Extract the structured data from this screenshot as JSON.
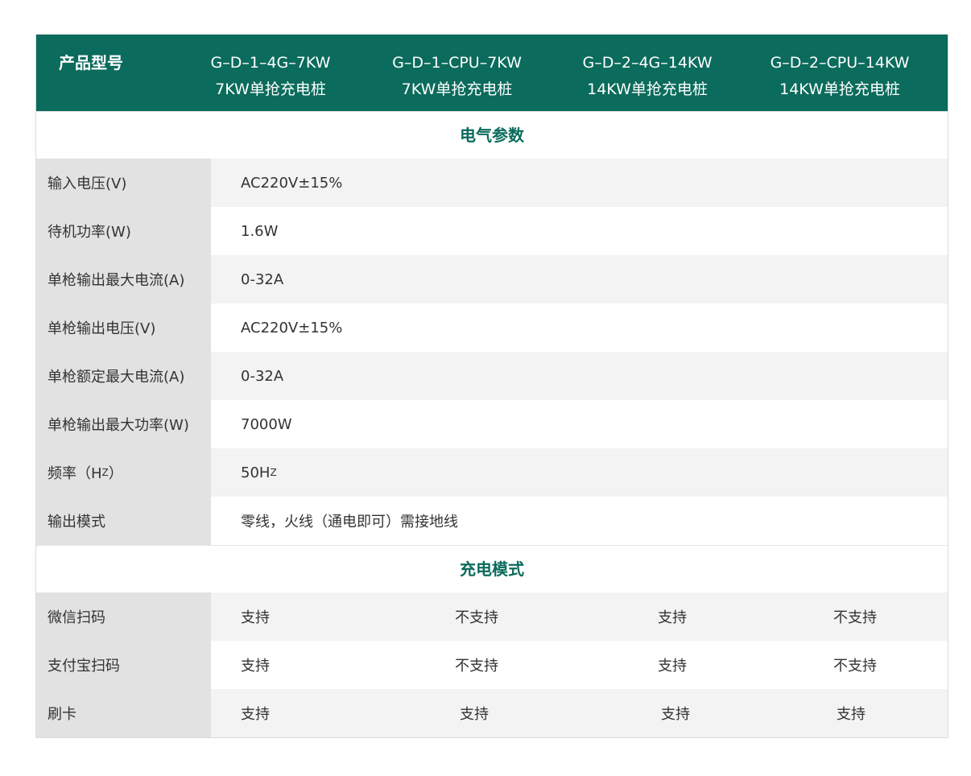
{
  "header": {
    "label": "产品型号",
    "models": [
      {
        "code": "G–D–1–4G–7KW",
        "desc": "7KW单抢充电桩"
      },
      {
        "code": "G–D–1–CPU–7KW",
        "desc": "7KW单抢充电桩"
      },
      {
        "code": "G–D–2–4G–14KW",
        "desc": "14KW单抢充电桩"
      },
      {
        "code": "G–D–2–CPU–14KW",
        "desc": "14KW单抢充电桩"
      }
    ]
  },
  "electrical": {
    "title": "电气参数",
    "rows": [
      {
        "label": "输入电压(V)",
        "value": "AC220V±15%"
      },
      {
        "label": "待机功率(W)",
        "value": "1.6W"
      },
      {
        "label": "单枪输出最大电流(A)",
        "value": "0-32A"
      },
      {
        "label": "单枪输出电压(V)",
        "value": "AC220V±15%"
      },
      {
        "label": "单枪额定最大电流(A)",
        "value": "0-32A"
      },
      {
        "label": "单枪输出最大功率(W)",
        "value": "7000W"
      },
      {
        "label": "频率（H",
        "label_sub": "Z",
        "label_end": "）",
        "value": "50H",
        "value_sub": "Z"
      },
      {
        "label": "输出模式",
        "value": "零线，火线（通电即可）需接地线"
      }
    ]
  },
  "charging": {
    "title": "充电模式",
    "rows": [
      {
        "label": "微信扫码",
        "values": [
          "支持",
          "不支持",
          "支持",
          "不支持"
        ]
      },
      {
        "label": "支付宝扫码",
        "values": [
          "支持",
          "不支持",
          "支持",
          "不支持"
        ]
      },
      {
        "label": "刷卡",
        "values": [
          "支持",
          "支持",
          "支持",
          "支持"
        ]
      }
    ]
  },
  "colors": {
    "header_bg": "#0b6b5c",
    "section_title": "#0b6b5c",
    "label_bg": "#e2e2e2",
    "row_alt": "#f3f3f3"
  }
}
